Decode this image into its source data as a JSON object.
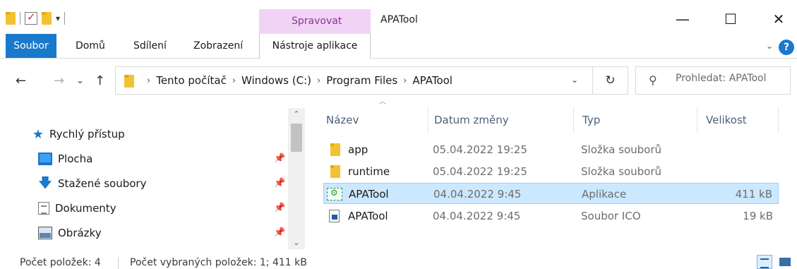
{
  "titlebar": {
    "context_group": "Spravovat",
    "title": "APATool",
    "minimize": "—",
    "maximize": "☐",
    "close": "✕"
  },
  "ribbon": {
    "tabs": [
      "Soubor",
      "Domů",
      "Sdílení",
      "Zobrazení",
      "Nástroje aplikace"
    ],
    "chevron": "⌄",
    "help": "?"
  },
  "address": {
    "back": "←",
    "forward": "→",
    "recent": "⌄",
    "up": "↑",
    "breadcrumbs": [
      "Tento počítač",
      "Windows (C:)",
      "Program Files",
      "APATool"
    ],
    "separator": "›",
    "dropdown": "⌄",
    "refresh": "↻"
  },
  "search": {
    "icon": "⚲",
    "placeholder": "Prohledat: APATool"
  },
  "navpane": {
    "quick_access": "Rychlý přístup",
    "items": [
      {
        "label": "Plocha",
        "icon": "desktop-icon",
        "pinned": true
      },
      {
        "label": "Stažené soubory",
        "icon": "download-icon",
        "pinned": true
      },
      {
        "label": "Dokumenty",
        "icon": "documents-icon",
        "pinned": true
      },
      {
        "label": "Obrázky",
        "icon": "pictures-icon",
        "pinned": true
      }
    ],
    "pin_glyph": "📌",
    "scroll_up": "⌃",
    "scroll_down": "⌄"
  },
  "filelist": {
    "columns": [
      "Název",
      "Datum změny",
      "Typ",
      "Velikost"
    ],
    "sort_arrow": "︿",
    "rows": [
      {
        "name": "app",
        "date": "05.04.2022 19:25",
        "type": "Složka souborů",
        "size": "",
        "icon": "folder-icon",
        "selected": false
      },
      {
        "name": "runtime",
        "date": "05.04.2022 19:25",
        "type": "Složka souborů",
        "size": "",
        "icon": "folder-icon",
        "selected": false
      },
      {
        "name": "APATool",
        "date": "04.04.2022 9:45",
        "type": "Aplikace",
        "size": "411 kB",
        "icon": "application-icon",
        "selected": true
      },
      {
        "name": "APATool",
        "date": "04.04.2022 9:45",
        "type": "Soubor ICO",
        "size": "19 kB",
        "icon": "ico-file-icon",
        "selected": false
      }
    ]
  },
  "statusbar": {
    "item_count": "Počet položek: 4",
    "selected_count": "Počet vybraných položek: 1; 411 kB"
  },
  "colors": {
    "file_tab": "#1979ca",
    "context_tab": "#f1d4f5",
    "selection": "#cce8ff",
    "header_text": "#4c607a"
  }
}
